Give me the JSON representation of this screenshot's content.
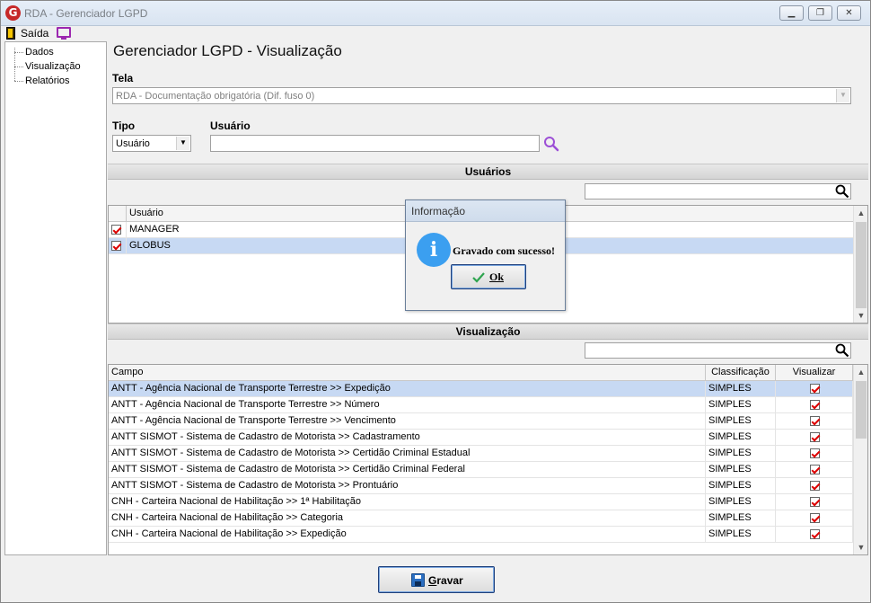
{
  "window": {
    "title": "RDA - Gerenciador LGPD",
    "app_icon_letter": "G"
  },
  "menubar": {
    "exit_label": "Saída"
  },
  "nav": {
    "items": [
      "Dados",
      "Visualização",
      "Relatórios"
    ]
  },
  "page_title": "Gerenciador LGPD - Visualização",
  "tela": {
    "label": "Tela",
    "value": "RDA - Documentação obrigatória (Dif. fuso 0)"
  },
  "tipo": {
    "label": "Tipo",
    "value": "Usuário"
  },
  "usuario": {
    "label": "Usuário",
    "value": ""
  },
  "usuarios_section": {
    "title": "Usuários",
    "search_value": "",
    "column": "Usuário",
    "rows": [
      {
        "name": "MANAGER",
        "checked": true,
        "selected": false
      },
      {
        "name": "GLOBUS",
        "checked": true,
        "selected": true
      }
    ]
  },
  "visualizacao_section": {
    "title": "Visualização",
    "search_value": "",
    "columns": [
      "Campo",
      "Classificação",
      "Visualizar"
    ],
    "rows": [
      {
        "campo": "ANTT - Agência Nacional de Transporte Terrestre >> Expedição",
        "classificacao": "SIMPLES",
        "visualizar": true,
        "selected": true
      },
      {
        "campo": "ANTT - Agência Nacional de Transporte Terrestre >> Número",
        "classificacao": "SIMPLES",
        "visualizar": true,
        "selected": false
      },
      {
        "campo": "ANTT - Agência Nacional de Transporte Terrestre >> Vencimento",
        "classificacao": "SIMPLES",
        "visualizar": true,
        "selected": false
      },
      {
        "campo": "ANTT SISMOT - Sistema de Cadastro de Motorista >> Cadastramento",
        "classificacao": "SIMPLES",
        "visualizar": true,
        "selected": false
      },
      {
        "campo": "ANTT SISMOT - Sistema de Cadastro de Motorista >> Certidão Criminal Estadual",
        "classificacao": "SIMPLES",
        "visualizar": true,
        "selected": false
      },
      {
        "campo": "ANTT SISMOT - Sistema de Cadastro de Motorista >> Certidão Criminal Federal",
        "classificacao": "SIMPLES",
        "visualizar": true,
        "selected": false
      },
      {
        "campo": "ANTT SISMOT - Sistema de Cadastro de Motorista >> Prontuário",
        "classificacao": "SIMPLES",
        "visualizar": true,
        "selected": false
      },
      {
        "campo": "CNH - Carteira Nacional de Habilitação >> 1ª Habilitação",
        "classificacao": "SIMPLES",
        "visualizar": true,
        "selected": false
      },
      {
        "campo": "CNH - Carteira Nacional de Habilitação >> Categoria",
        "classificacao": "SIMPLES",
        "visualizar": true,
        "selected": false
      },
      {
        "campo": "CNH - Carteira Nacional de Habilitação >> Expedição",
        "classificacao": "SIMPLES",
        "visualizar": true,
        "selected": false
      }
    ]
  },
  "dialog": {
    "title": "Informação",
    "icon_letter": "i",
    "message": "Gravado com sucesso!",
    "ok_label": "Ok"
  },
  "gravar_label": "Gravar",
  "colors": {
    "selection": "#c7d9f3",
    "checkmark": "#dd0000",
    "info_icon": "#3b9ff0",
    "title_bar": "#dce6f2"
  }
}
